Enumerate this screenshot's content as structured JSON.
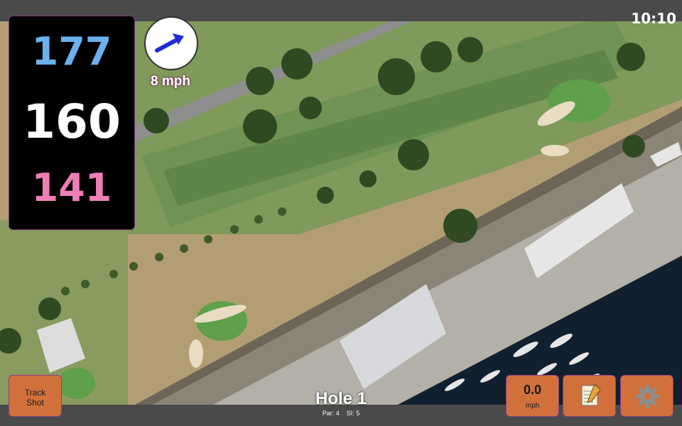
{
  "status": {
    "time": "10:10"
  },
  "yardage": {
    "back": "177",
    "center": "160",
    "front": "141"
  },
  "wind": {
    "speed_label": "8 mph",
    "arrow_icon": "wind-direction-arrow-icon"
  },
  "buttons": {
    "track_shot_line1": "Track",
    "track_shot_line2": "Shot",
    "speed_value": "0.0",
    "speed_unit": "mph",
    "notes_icon": "notepad-icon",
    "settings_icon": "gear-icon"
  },
  "hole": {
    "title": "Hole 1",
    "par": "Par: 4",
    "si": "SI: 5"
  },
  "colors": {
    "back": "#6ab1f0",
    "center": "#ffffff",
    "front": "#ef7fb6",
    "button": "#d2703c",
    "wind_text_glow": "#7b1f66"
  }
}
